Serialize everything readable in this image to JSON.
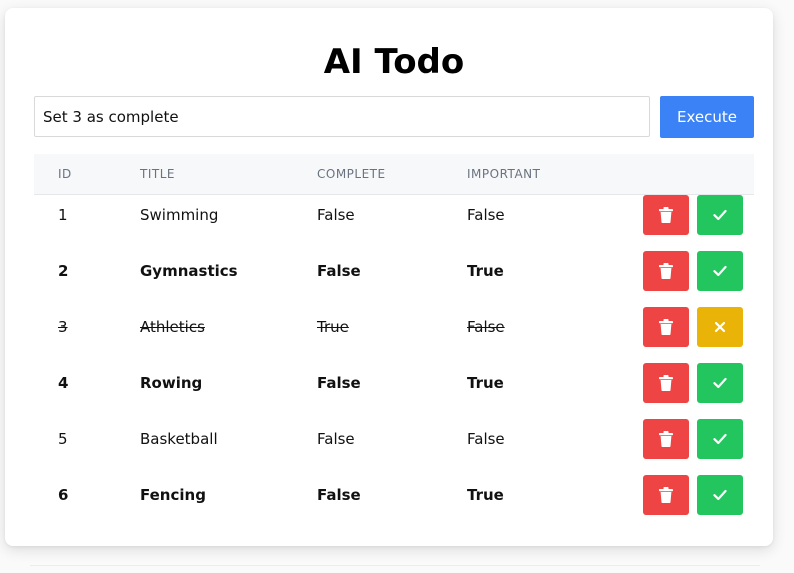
{
  "app": {
    "title": "AI Todo"
  },
  "command": {
    "value": "Set 3 as complete",
    "execute_label": "Execute"
  },
  "colors": {
    "accent": "#3b82f6",
    "delete": "#ef4444",
    "complete": "#22c55e",
    "undo": "#eab308"
  },
  "table": {
    "headers": {
      "id": "ID",
      "title": "TITLE",
      "complete": "COMPLETE",
      "important": "IMPORTANT"
    },
    "rows": [
      {
        "id": "1",
        "title": "Swimming",
        "complete": "False",
        "important": "False",
        "toggle_icon": "check-icon"
      },
      {
        "id": "2",
        "title": "Gymnastics",
        "complete": "False",
        "important": "True",
        "toggle_icon": "check-icon"
      },
      {
        "id": "3",
        "title": "Athletics",
        "complete": "True",
        "important": "False",
        "toggle_icon": "x-icon"
      },
      {
        "id": "4",
        "title": "Rowing",
        "complete": "False",
        "important": "True",
        "toggle_icon": "check-icon"
      },
      {
        "id": "5",
        "title": "Basketball",
        "complete": "False",
        "important": "False",
        "toggle_icon": "check-icon"
      },
      {
        "id": "6",
        "title": "Fencing",
        "complete": "False",
        "important": "True",
        "toggle_icon": "check-icon"
      }
    ],
    "delete_icon": "trash-icon"
  }
}
